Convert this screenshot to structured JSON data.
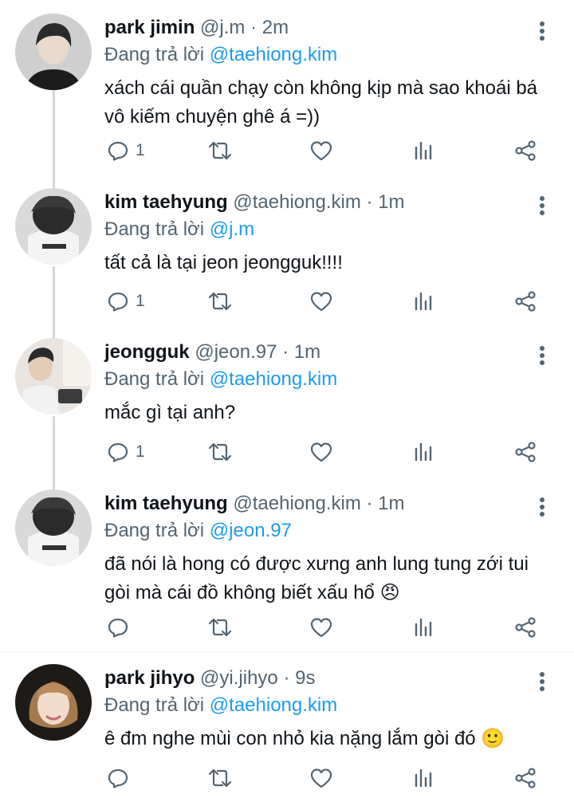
{
  "reply_prefix": "Đang trả lời",
  "tweets": [
    {
      "name": "park jimin",
      "handle": "@j.m",
      "time": "2m",
      "reply_to": "@taehiong.kim",
      "text": "xách cái quần chạy còn không kịp mà sao khoái bá vô kiếm chuyện ghê á =))",
      "reply_count": "1"
    },
    {
      "name": "kim taehyung",
      "handle": "@taehiong.kim",
      "time": "1m",
      "reply_to": "@j.m",
      "text": "tất cả là tại jeon jeongguk!!!!",
      "reply_count": "1"
    },
    {
      "name": "jeongguk",
      "handle": "@jeon.97",
      "time": "1m",
      "reply_to": "@taehiong.kim",
      "text": "mắc gì tại anh?",
      "reply_count": "1"
    },
    {
      "name": "kim taehyung",
      "handle": "@taehiong.kim",
      "time": "1m",
      "reply_to": "@jeon.97",
      "text": "đã nói là hong có được xưng anh lung tung zới tui gòi mà cái đồ không biết xấu hổ 😠",
      "reply_count": ""
    },
    {
      "name": "park jihyo",
      "handle": "@yi.jihyo",
      "time": "9s",
      "reply_to": "@taehiong.kim",
      "text": "ê đm nghe mùi con nhỏ kia nặng lắm gòi đó 🙂",
      "reply_count": ""
    }
  ],
  "colors": {
    "accent": "#1d9bf0",
    "secondary_text": "#536471",
    "thread_line": "#cfd9de"
  },
  "icons": {
    "reply": "reply-icon",
    "retweet": "retweet-icon",
    "like": "heart-icon",
    "views": "views-chart-icon",
    "share": "share-icon",
    "more": "more-vertical-icon"
  }
}
